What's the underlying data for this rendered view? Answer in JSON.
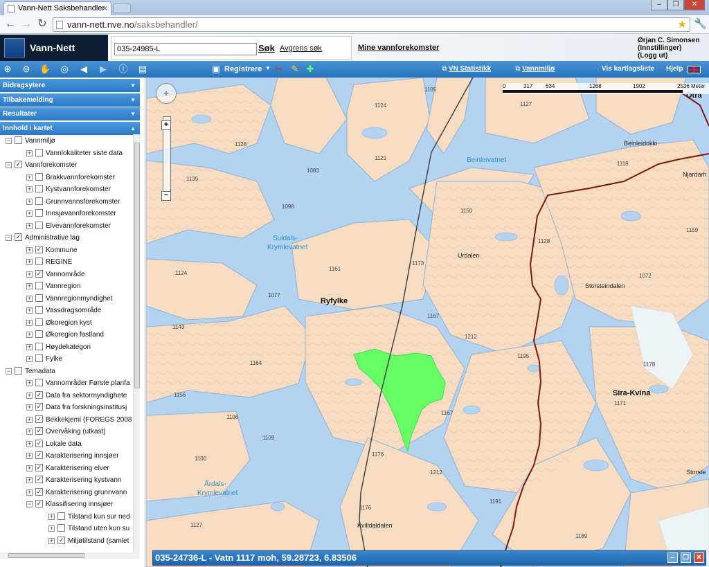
{
  "browser": {
    "tab_title": "Vann-Nett Saksbehandler",
    "tab_close": "×",
    "url_host": "vann-nett.nve.no",
    "url_path": "/saksbehandler/"
  },
  "header": {
    "brand": "Vann-Nett",
    "search_value": "035-24985-L",
    "search_button": "Søk",
    "refine_link": "Avgrens søk",
    "my_waters_link": "Mine vannforekomster",
    "user_name": "Ørjan C. Simonsen",
    "user_settings": "(Innstillinger)",
    "user_logout": "(Logg ut)"
  },
  "toolbar": {
    "register": "Registrere",
    "vn_stats": "VN Statistikk",
    "water_env": "Vannmiljø",
    "show_layers": "Vis kartlagsliste",
    "help": "Hjelp"
  },
  "sidebar": {
    "panels": [
      "Bidragsytere",
      "Tilbakemelding",
      "Resultater",
      "Innhold i kartet"
    ],
    "tree": [
      {
        "label": "Vannmiljø",
        "level": 0,
        "exp": "−",
        "checked": false
      },
      {
        "label": "Vannlokaliteter siste data",
        "level": 1,
        "exp": "+",
        "checked": false
      },
      {
        "label": "Vannforekomster",
        "level": 0,
        "exp": "−",
        "checked": true
      },
      {
        "label": "Brakkvannforekomster",
        "level": 1,
        "exp": "+",
        "checked": false
      },
      {
        "label": "Kystvannforekomster",
        "level": 1,
        "exp": "+",
        "checked": false
      },
      {
        "label": "Grunnvannsforekomster",
        "level": 1,
        "exp": "+",
        "checked": false
      },
      {
        "label": "Innsjøvannforekomster",
        "level": 1,
        "exp": "+",
        "checked": false
      },
      {
        "label": "Elvevannforekomster",
        "level": 1,
        "exp": "+",
        "checked": false
      },
      {
        "label": "Administrative lag",
        "level": 0,
        "exp": "−",
        "checked": true
      },
      {
        "label": "Kommune",
        "level": 1,
        "exp": "+",
        "checked": true
      },
      {
        "label": "REGINE",
        "level": 1,
        "exp": "+",
        "checked": false
      },
      {
        "label": "Vannområde",
        "level": 1,
        "exp": "+",
        "checked": true
      },
      {
        "label": "Vannregion",
        "level": 1,
        "exp": "+",
        "checked": false
      },
      {
        "label": "Vannregionmyndighet",
        "level": 1,
        "exp": "+",
        "checked": false
      },
      {
        "label": "Vassdragsområde",
        "level": 1,
        "exp": "+",
        "checked": false
      },
      {
        "label": "Økoregion kyst",
        "level": 1,
        "exp": "+",
        "checked": false
      },
      {
        "label": "Økoregion fastland",
        "level": 1,
        "exp": "+",
        "checked": false
      },
      {
        "label": "Høydekategori",
        "level": 1,
        "exp": "+",
        "checked": false
      },
      {
        "label": "Fylke",
        "level": 1,
        "exp": "+",
        "checked": false
      },
      {
        "label": "Temadata",
        "level": 0,
        "exp": "−",
        "checked": false
      },
      {
        "label": "Vannområder Første planfa",
        "level": 1,
        "exp": "+",
        "checked": false
      },
      {
        "label": "Data fra sektormyndighete",
        "level": 1,
        "exp": "+",
        "checked": true
      },
      {
        "label": "Data fra forskningsinstitusj",
        "level": 1,
        "exp": "+",
        "checked": true
      },
      {
        "label": "Bekkekjemi (FOREGS 2008",
        "level": 1,
        "exp": "+",
        "checked": true
      },
      {
        "label": "Overvåking (utkast)",
        "level": 1,
        "exp": "+",
        "checked": true
      },
      {
        "label": "Lokale data",
        "level": 1,
        "exp": "+",
        "checked": true
      },
      {
        "label": "Karakterisering innsjøer",
        "level": 1,
        "exp": "+",
        "checked": true
      },
      {
        "label": "Karakterisering elver",
        "level": 1,
        "exp": "+",
        "checked": true
      },
      {
        "label": "Karakterisering kystvann",
        "level": 1,
        "exp": "+",
        "checked": true
      },
      {
        "label": "Karakterisering grunnvann",
        "level": 1,
        "exp": "+",
        "checked": true
      },
      {
        "label": "Klassifisering innsjøer",
        "level": 1,
        "exp": "−",
        "checked": true
      },
      {
        "label": "Tilstand kun sur ned",
        "level": 2,
        "exp": "+",
        "checked": false
      },
      {
        "label": "Tilstand uten kun su",
        "level": 2,
        "exp": "+",
        "checked": false
      },
      {
        "label": "Miljøtilstand (samlet",
        "level": 2,
        "exp": "+",
        "checked": true
      }
    ]
  },
  "map": {
    "scale_labels": [
      "0",
      "317",
      "634",
      "1268",
      "1902",
      "2536 Meter"
    ],
    "place_names": [
      {
        "text": "Otra",
        "cls": "b"
      },
      {
        "text": "Beinleidokki",
        "cls": ""
      },
      {
        "text": "Njardarh",
        "cls": ""
      },
      {
        "text": "Beinleivatnet",
        "cls": "w"
      },
      {
        "text": "Suldals-",
        "cls": "w"
      },
      {
        "text": "Krymlevatnet",
        "cls": "w"
      },
      {
        "text": "Urdalen",
        "cls": ""
      },
      {
        "text": "Storsteindalen",
        "cls": ""
      },
      {
        "text": "Ryfylke",
        "cls": "b"
      },
      {
        "text": "Sira-Kvina",
        "cls": "b"
      },
      {
        "text": "Årdals-",
        "cls": "w"
      },
      {
        "text": "Krymlevatnet",
        "cls": "w"
      },
      {
        "text": "Kvilldaldalen",
        "cls": ""
      },
      {
        "text": "Storste",
        "cls": ""
      }
    ],
    "elevations": [
      "1105",
      "1124",
      "1127",
      "1128",
      "1121",
      "1083",
      "1135",
      "1098",
      "1118",
      "1150",
      "1159",
      "1128",
      "1161",
      "1173",
      "1072",
      "1124",
      "1077",
      "1167",
      "1212",
      "1195",
      "1143",
      "1164",
      "1178",
      "1156",
      "1106",
      "1171",
      "1109",
      "1167",
      "1100",
      "1176",
      "1212",
      "1127",
      "1176",
      "1191",
      "1189"
    ],
    "status_text": "035-24736-L - Vatn 1117 moh, 59.28723, 6.83506",
    "accent_lake_color": "#66ff66",
    "boundary_color": "#7a1a12"
  }
}
